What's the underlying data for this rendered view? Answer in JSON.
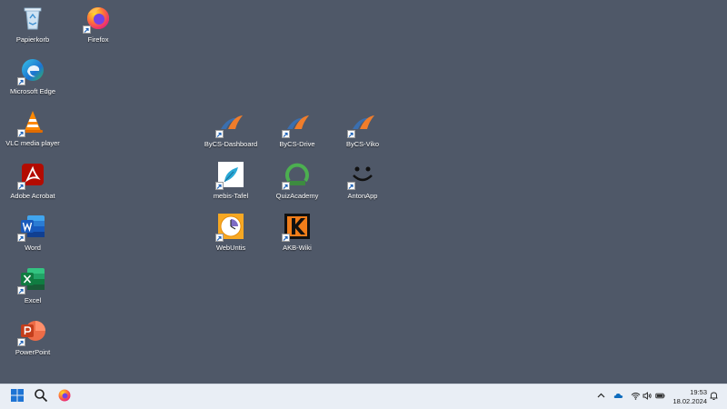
{
  "desktop": {
    "icons": [
      {
        "label": "Papierkorb",
        "icon": "recycle-bin-icon"
      },
      {
        "label": "Firefox",
        "icon": "firefox-icon"
      },
      {
        "label": "Microsoft Edge",
        "icon": "edge-icon"
      },
      {
        "label": "VLC media player",
        "icon": "vlc-icon"
      },
      {
        "label": "Adobe Acrobat",
        "icon": "acrobat-icon"
      },
      {
        "label": "Word",
        "icon": "word-icon"
      },
      {
        "label": "Excel",
        "icon": "excel-icon"
      },
      {
        "label": "PowerPoint",
        "icon": "powerpoint-icon"
      },
      {
        "label": "ByCS-Dashboard",
        "icon": "bycs-icon"
      },
      {
        "label": "ByCS-Drive",
        "icon": "bycs-icon"
      },
      {
        "label": "ByCS-Viko",
        "icon": "bycs-icon"
      },
      {
        "label": "mebis-Tafel",
        "icon": "mebis-icon"
      },
      {
        "label": "QuizAcademy",
        "icon": "quizacademy-icon"
      },
      {
        "label": "AntonApp",
        "icon": "anton-icon"
      },
      {
        "label": "WebUntis",
        "icon": "webuntis-icon"
      },
      {
        "label": "AKB-Wiki",
        "icon": "akb-wiki-icon"
      }
    ]
  },
  "taskbar": {
    "items": [
      "start-icon",
      "search-icon",
      "firefox-icon"
    ],
    "tray": [
      "chevron-up-icon",
      "onedrive-icon",
      "wifi-icon",
      "volume-icon",
      "battery-icon",
      "notification-bell-icon"
    ],
    "time": "19:53",
    "date": "18.02.2024"
  },
  "colors": {
    "desktop_background": "#4f5868",
    "taskbar_background": "#e9eef5"
  }
}
